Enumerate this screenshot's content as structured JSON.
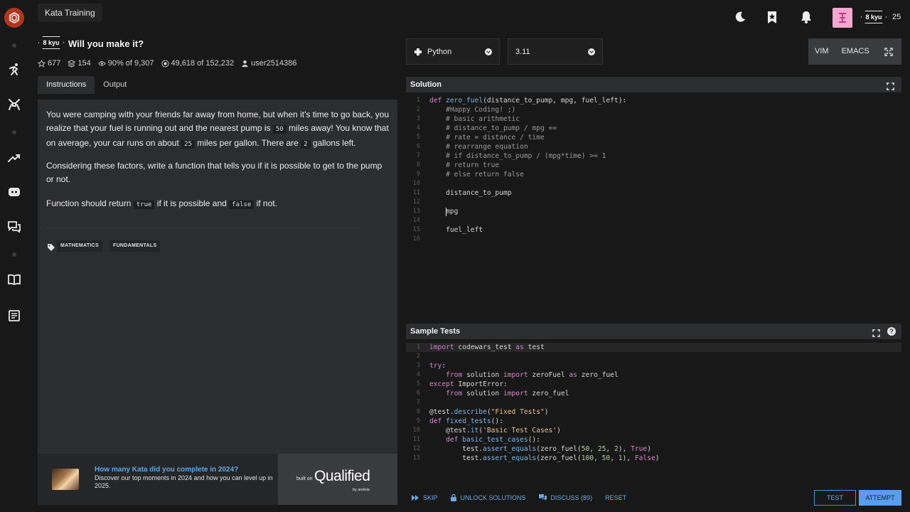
{
  "breadcrumb": "Kata Training",
  "user": {
    "rank": "8 kyu",
    "honor": "25"
  },
  "kata": {
    "rank": "8 kyu",
    "title": "Will you make it?",
    "stats": {
      "stars": "677",
      "collections": "154",
      "satisfaction": "90%",
      "satisfaction_suffix": "of 9,307",
      "completed": "49,618",
      "completed_suffix": "of 152,232",
      "author": "user2514386"
    }
  },
  "tabs": {
    "instructions": "Instructions",
    "output": "Output"
  },
  "description": {
    "p1_a": "You were camping with your friends far away from home, but when it's time to go back, you realize that your fuel is running out and the nearest pump is ",
    "p1_code1": "50",
    "p1_b": " miles away! You know that on average, your car runs on about ",
    "p1_code2": "25",
    "p1_c": " miles per gallon. There are ",
    "p1_code3": "2",
    "p1_d": " gallons left.",
    "p2": "Considering these factors, write a function that tells you if it is possible to get to the pump or not.",
    "p3_a": "Function should return ",
    "p3_code1": "true",
    "p3_b": " if it is possible and ",
    "p3_code2": "false",
    "p3_c": " if not."
  },
  "tags": [
    "MATHEMATICS",
    "FUNDAMENTALS"
  ],
  "promo": {
    "title": "How many Kata did you complete in 2024?",
    "body": "Discover our top moments in 2024 and how you can level up in 2025.",
    "built_on": "built on",
    "brand": "Qualified",
    "by": "by andela"
  },
  "editor_toolbar": {
    "language": "Python",
    "version": "3.11",
    "vim": "VIM",
    "emacs": "EMACS"
  },
  "solution": {
    "title": "Solution",
    "lines": [
      "def zero_fuel(distance_to_pump, mpg, fuel_left):",
      "    #Happy Coding! ;)",
      "    # basic arithmetic",
      "    # distance_to_pump / mpg ==",
      "    # rate = distance / time",
      "    # rearrange equation",
      "    # if distance_to_pump / (mpg*time) >= 1",
      "    # return true",
      "    # else return false",
      "",
      "    distance_to_pump",
      "",
      "    mpg",
      "",
      "    fuel_left",
      ""
    ]
  },
  "sample_tests": {
    "title": "Sample Tests",
    "lines": [
      "import codewars_test as test",
      "",
      "try:",
      "    from solution import zeroFuel as zero_fuel",
      "except ImportError:",
      "    from solution import zero_fuel",
      "",
      "@test.describe(\"Fixed Tests\")",
      "def fixed_tests():",
      "    @test.it('Basic Test Cases')",
      "    def basic_test_cases():",
      "        test.assert_equals(zero_fuel(50, 25, 2), True)",
      "        test.assert_equals(zero_fuel(100, 50, 1), False)"
    ]
  },
  "actions": {
    "skip": "SKIP",
    "unlock": "UNLOCK SOLUTIONS",
    "discuss": "DISCUSS (89)",
    "reset": "RESET",
    "test": "TEST",
    "attempt": "ATTEMPT"
  }
}
